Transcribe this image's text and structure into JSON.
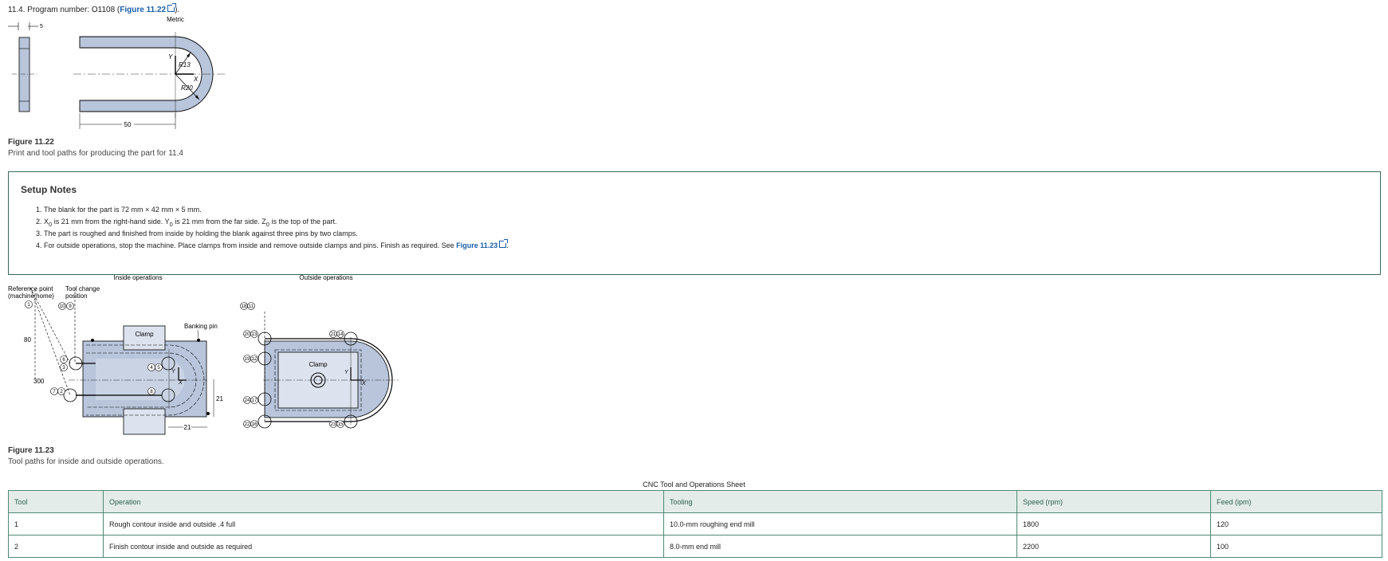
{
  "heading": {
    "text": "11.4. Program number: O1108 (",
    "link": "Figure 11.22",
    "close": ")."
  },
  "figure1": {
    "labels": {
      "metric": "Metric",
      "dim_5": "5",
      "dim_50": "50",
      "r13": "R13",
      "r20": "R20",
      "axis_y": "Y",
      "axis_x": "X"
    },
    "caption_number": "Figure 11.22",
    "caption_text": "Print and tool paths for producing the part for 11.4"
  },
  "setup_notes": {
    "title": "Setup Notes",
    "items": [
      {
        "pre": "The blank for the part is 72 mm × 42 mm × 5 mm."
      },
      {
        "pre": "X",
        "sub1": "0",
        "mid1": " is 21 mm from the right-hand side. Y",
        "sub2": "0",
        "mid2": " is 21 mm from the far side. Z",
        "sub3": "0",
        "post": " is the top of the part."
      },
      {
        "pre": "The part is roughed and finished from inside by holding the blank against three pins by two clamps."
      },
      {
        "pre": "For outside operations, stop the machine. Place clamps from inside and remove outside clamps and pins. Finish as required. See ",
        "link": "Figure 11.23",
        "post": "."
      }
    ]
  },
  "figure2": {
    "labels": {
      "inside": "Inside operations",
      "outside": "Outside operations",
      "ref_point_1": "Reference point",
      "ref_point_2": "(machine home)",
      "tool_change_1": "Tool change",
      "tool_change_2": "position",
      "clamp": "Clamp",
      "banking_pin": "Banking pin",
      "dim_80": "80",
      "dim_300": "300",
      "dim_21a": "21",
      "dim_21b": "21",
      "axis_y": "Y",
      "axis_x": "X"
    },
    "markers": {
      "inside": [
        "1",
        "10",
        "9",
        "4",
        "5",
        "6",
        "8",
        "7",
        "2",
        "3"
      ],
      "outside": [
        "18",
        "11",
        "20",
        "13",
        "19",
        "12",
        "24",
        "17",
        "22",
        "16",
        "21",
        "14",
        "23",
        "15"
      ]
    },
    "caption_number": "Figure 11.23",
    "caption_text": "Tool paths for inside and outside operations."
  },
  "table": {
    "title": "CNC Tool and Operations Sheet",
    "headers": [
      "Tool",
      "Operation",
      "Tooling",
      "Speed (rpm)",
      "Feed (ipm)"
    ],
    "rows": [
      [
        "1",
        "Rough contour inside and outside .4 full",
        "10.0-mm roughing end mill",
        "1800",
        "120"
      ],
      [
        "2",
        "Finish contour inside and outside as required",
        "8.0-mm end mill",
        "2200",
        "100"
      ]
    ]
  },
  "colors": {
    "part_fill": "#b8c5db",
    "link": "#1a5ea8",
    "table_border": "#4f8a73",
    "table_header_bg": "#e3ece8"
  }
}
